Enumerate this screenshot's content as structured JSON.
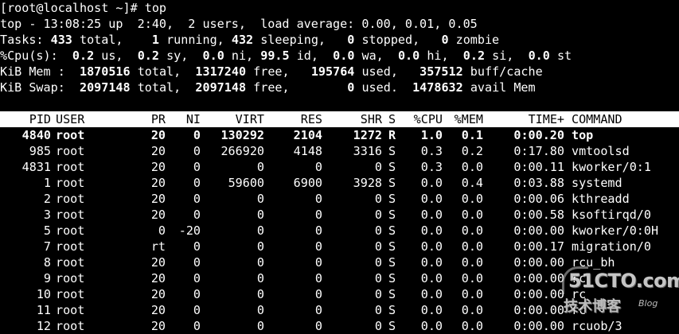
{
  "prompt": {
    "text": "[root@localhost ~]# top"
  },
  "summary": {
    "top_line": "top - 13:08:25 up  2:40,  2 users,  load average: 0.00, 0.01, 0.05",
    "tasks": {
      "label": "Tasks:",
      "total": "433",
      "total_label": "total,",
      "running": "1",
      "running_label": "running,",
      "sleeping": "432",
      "sleeping_label": "sleeping,",
      "stopped": "0",
      "stopped_label": "stopped,",
      "zombie": "0",
      "zombie_label": "zombie"
    },
    "cpu": {
      "label": "%Cpu(s):",
      "us": "0.2",
      "us_label": "us,",
      "sy": "0.2",
      "sy_label": "sy,",
      "ni": "0.0",
      "ni_label": "ni,",
      "id": "99.5",
      "id_label": "id,",
      "wa": "0.0",
      "wa_label": "wa,",
      "hi": "0.0",
      "hi_label": "hi,",
      "si": "0.2",
      "si_label": "si,",
      "st": "0.0",
      "st_label": "st"
    },
    "mem": {
      "label": "KiB Mem :",
      "total": "1870516",
      "total_label": "total,",
      "free": "1317240",
      "free_label": "free,",
      "used": "195764",
      "used_label": "used,",
      "buff_cache": "357512",
      "buff_cache_label": "buff/cache"
    },
    "swap": {
      "label": "KiB Swap:",
      "total": "2097148",
      "total_label": "total,",
      "free": "2097148",
      "free_label": "free,",
      "used": "0",
      "used_label": "used.",
      "avail": "1478632",
      "avail_label": "avail Mem"
    }
  },
  "table": {
    "headers": {
      "pid": "PID",
      "user": "USER",
      "pr": "PR",
      "ni": "NI",
      "virt": "VIRT",
      "res": "RES",
      "shr": "SHR",
      "s": "S",
      "cpu": "%CPU",
      "mem": "%MEM",
      "time": "TIME+",
      "command": "COMMAND"
    },
    "rows": [
      {
        "pid": "4840",
        "user": "root",
        "pr": "20",
        "ni": "0",
        "virt": "130292",
        "res": "2104",
        "shr": "1272",
        "s": "R",
        "cpu": "1.0",
        "mem": "0.1",
        "time": "0:00.20",
        "command": "top"
      },
      {
        "pid": "985",
        "user": "root",
        "pr": "20",
        "ni": "0",
        "virt": "266920",
        "res": "4148",
        "shr": "3316",
        "s": "S",
        "cpu": "0.3",
        "mem": "0.2",
        "time": "0:17.80",
        "command": "vmtoolsd"
      },
      {
        "pid": "4831",
        "user": "root",
        "pr": "20",
        "ni": "0",
        "virt": "0",
        "res": "0",
        "shr": "0",
        "s": "S",
        "cpu": "0.3",
        "mem": "0.0",
        "time": "0:00.11",
        "command": "kworker/0:1"
      },
      {
        "pid": "1",
        "user": "root",
        "pr": "20",
        "ni": "0",
        "virt": "59600",
        "res": "6900",
        "shr": "3928",
        "s": "S",
        "cpu": "0.0",
        "mem": "0.4",
        "time": "0:03.88",
        "command": "systemd"
      },
      {
        "pid": "2",
        "user": "root",
        "pr": "20",
        "ni": "0",
        "virt": "0",
        "res": "0",
        "shr": "0",
        "s": "S",
        "cpu": "0.0",
        "mem": "0.0",
        "time": "0:00.06",
        "command": "kthreadd"
      },
      {
        "pid": "3",
        "user": "root",
        "pr": "20",
        "ni": "0",
        "virt": "0",
        "res": "0",
        "shr": "0",
        "s": "S",
        "cpu": "0.0",
        "mem": "0.0",
        "time": "0:00.58",
        "command": "ksoftirqd/0"
      },
      {
        "pid": "5",
        "user": "root",
        "pr": "0",
        "ni": "-20",
        "virt": "0",
        "res": "0",
        "shr": "0",
        "s": "S",
        "cpu": "0.0",
        "mem": "0.0",
        "time": "0:00.00",
        "command": "kworker/0:0H"
      },
      {
        "pid": "7",
        "user": "root",
        "pr": "rt",
        "ni": "0",
        "virt": "0",
        "res": "0",
        "shr": "0",
        "s": "S",
        "cpu": "0.0",
        "mem": "0.0",
        "time": "0:00.17",
        "command": "migration/0"
      },
      {
        "pid": "8",
        "user": "root",
        "pr": "20",
        "ni": "0",
        "virt": "0",
        "res": "0",
        "shr": "0",
        "s": "S",
        "cpu": "0.0",
        "mem": "0.0",
        "time": "0:00.00",
        "command": "rcu_bh"
      },
      {
        "pid": "9",
        "user": "root",
        "pr": "20",
        "ni": "0",
        "virt": "0",
        "res": "0",
        "shr": "0",
        "s": "S",
        "cpu": "0.0",
        "mem": "0.0",
        "time": "0:00.00",
        "command": "rc"
      },
      {
        "pid": "10",
        "user": "root",
        "pr": "20",
        "ni": "0",
        "virt": "0",
        "res": "0",
        "shr": "0",
        "s": "S",
        "cpu": "0.0",
        "mem": "0.0",
        "time": "0:00.00",
        "command": "rc"
      },
      {
        "pid": "11",
        "user": "root",
        "pr": "20",
        "ni": "0",
        "virt": "0",
        "res": "0",
        "shr": "0",
        "s": "S",
        "cpu": "0.0",
        "mem": "0.0",
        "time": "0:00.00",
        "command": "rc"
      },
      {
        "pid": "12",
        "user": "root",
        "pr": "20",
        "ni": "0",
        "virt": "0",
        "res": "0",
        "shr": "0",
        "s": "S",
        "cpu": "0.0",
        "mem": "0.0",
        "time": "0:00.00",
        "command": "rcuob/3"
      }
    ]
  },
  "watermark": {
    "main": "51CTO.com",
    "sub": "技术博客",
    "blog": "Blog"
  },
  "colors": {
    "background": "#000000",
    "text": "#ffffff",
    "header_bg": "#ffffff",
    "header_text": "#000000"
  }
}
